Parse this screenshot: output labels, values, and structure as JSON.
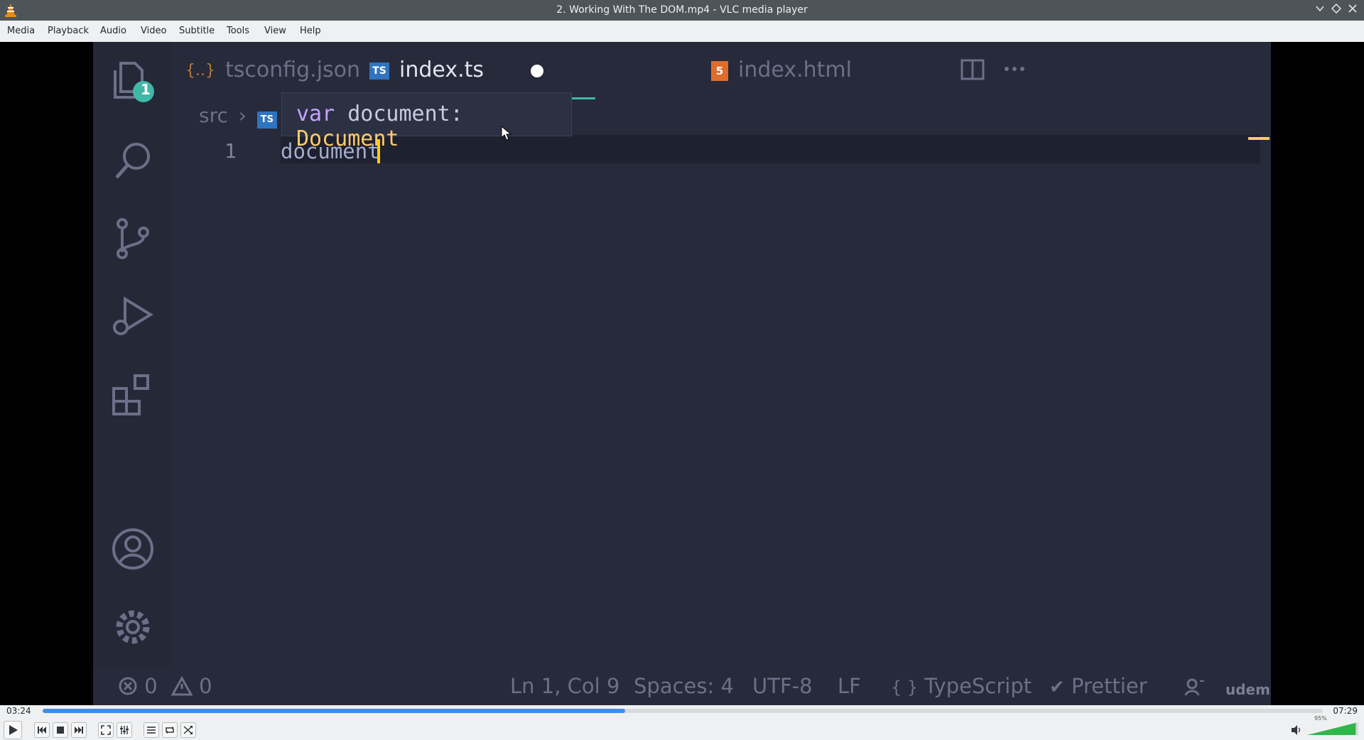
{
  "window": {
    "title": "2. Working With The DOM.mp4 - VLC media player",
    "logo_icon": "vlc-cone-icon",
    "controls": [
      "minimize-icon",
      "maximize-icon",
      "close-icon"
    ]
  },
  "menubar": {
    "items": [
      "Media",
      "Playback",
      "Audio",
      "Video",
      "Subtitle",
      "Tools",
      "View",
      "Help"
    ]
  },
  "video_frame": {
    "activity_bar": {
      "explorer_badge": "1",
      "icons": [
        "explorer-icon",
        "search-icon",
        "source-control-icon",
        "run-debug-icon",
        "extensions-icon",
        "account-icon",
        "settings-icon"
      ]
    },
    "tabs": [
      {
        "label": "tsconfig.json",
        "icon": "json-braces-icon",
        "active": false
      },
      {
        "label": "index.ts",
        "icon": "typescript-file-icon",
        "active": true,
        "unsaved_dot": true
      },
      {
        "label": "index.html",
        "icon": "html5-file-icon",
        "active": false
      }
    ],
    "breadcrumb": {
      "folder": "src",
      "file_icon_text": "TS"
    },
    "hover_tooltip": {
      "keyword": "var",
      "name": "document:",
      "type": "Document"
    },
    "editor": {
      "line_number": "1",
      "code": "document"
    },
    "statusbar": {
      "errors": "0",
      "warnings": "0",
      "position": "Ln 1, Col 9",
      "spaces": "Spaces: 4",
      "encoding": "UTF-8",
      "eol": "LF",
      "language": "TypeScript",
      "language_icon_text": "{ }",
      "formatter": "Prettier",
      "watermark": "udemy"
    }
  },
  "player": {
    "elapsed": "03:24",
    "total": "07:29",
    "progress_fraction": 0.455,
    "volume_percent_label": "95%",
    "volume_fraction": 0.95,
    "accent_color": "#3d8ee6",
    "volume_color": "#2fb84a",
    "buttons": [
      "play-icon",
      "previous-icon",
      "stop-icon",
      "next-icon",
      "fullscreen-icon",
      "extended-settings-icon",
      "playlist-icon",
      "loop-icon",
      "shuffle-icon"
    ]
  }
}
